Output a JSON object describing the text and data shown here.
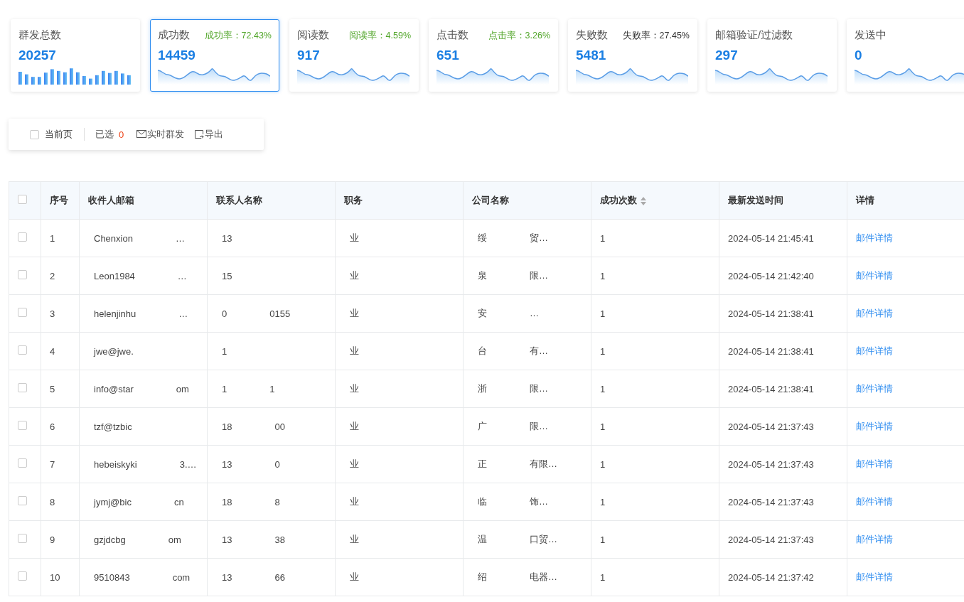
{
  "stats": [
    {
      "title": "群发总数",
      "value": "20257",
      "kind": "bars",
      "selected": false
    },
    {
      "title": "成功数",
      "value": "14459",
      "kind": "wave",
      "selected": true,
      "rate": {
        "text": "成功率：72.43%",
        "kind": "positive"
      }
    },
    {
      "title": "阅读数",
      "value": "917",
      "kind": "wave",
      "selected": false,
      "rate": {
        "text": "阅读率：4.59%",
        "kind": "positive"
      }
    },
    {
      "title": "点击数",
      "value": "651",
      "kind": "wave",
      "selected": false,
      "rate": {
        "text": "点击率：3.26%",
        "kind": "positive"
      }
    },
    {
      "title": "失败数",
      "value": "5481",
      "kind": "wave",
      "selected": false,
      "rate": {
        "text": "失败率：27.45%",
        "kind": "neutral"
      }
    },
    {
      "title": "邮箱验证/过滤数",
      "value": "297",
      "kind": "wave",
      "selected": false
    },
    {
      "title": "发送中",
      "value": "0",
      "kind": "wave",
      "selected": false
    }
  ],
  "toolbar": {
    "page_checkbox": {
      "label": "当前页",
      "checked": false
    },
    "selected_label": "已选",
    "selected_count": "0",
    "send_button": "实时群发",
    "export_button": "导出"
  },
  "table": {
    "all_checked": false,
    "columns": [
      {
        "label": "序号"
      },
      {
        "label": "收件人邮箱"
      },
      {
        "label": "联系人名称"
      },
      {
        "label": "职务"
      },
      {
        "label": "公司名称"
      },
      {
        "label": "成功次数",
        "sortable": true
      },
      {
        "label": "最新发送时间"
      },
      {
        "label": "详情"
      }
    ],
    "rows": [
      {
        "checked": false,
        "index": "1",
        "email": [
          "Chenxion",
          "…"
        ],
        "contact": [
          "13"
        ],
        "job": [
          "业"
        ],
        "company": [
          "绥",
          "贸…"
        ],
        "count": "1",
        "time": "2024-05-14 21:45:41",
        "link": "邮件详情"
      },
      {
        "checked": false,
        "index": "2",
        "email": [
          "Leon1984",
          "…"
        ],
        "contact": [
          "15"
        ],
        "job": [
          "业"
        ],
        "company": [
          "泉",
          "限…"
        ],
        "count": "1",
        "time": "2024-05-14 21:42:40",
        "link": "邮件详情"
      },
      {
        "checked": false,
        "index": "3",
        "email": [
          "helenjinhu",
          "…"
        ],
        "contact": [
          "0",
          "0155"
        ],
        "job": [
          "业"
        ],
        "company": [
          "安",
          "…"
        ],
        "count": "1",
        "time": "2024-05-14 21:38:41",
        "link": "邮件详情"
      },
      {
        "checked": false,
        "index": "4",
        "email": [
          "jwe@jwe."
        ],
        "contact": [
          "1"
        ],
        "job": [
          "业"
        ],
        "company": [
          "台",
          "有…"
        ],
        "count": "1",
        "time": "2024-05-14 21:38:41",
        "link": "邮件详情"
      },
      {
        "checked": false,
        "index": "5",
        "email": [
          "info@star",
          "om"
        ],
        "contact": [
          "1",
          "1"
        ],
        "job": [
          "业"
        ],
        "company": [
          "浙",
          "限…"
        ],
        "count": "1",
        "time": "2024-05-14 21:38:41",
        "link": "邮件详情"
      },
      {
        "checked": false,
        "index": "6",
        "email": [
          "tzf@tzbic"
        ],
        "contact": [
          "18",
          "00"
        ],
        "job": [
          "业"
        ],
        "company": [
          "广",
          "限…"
        ],
        "count": "1",
        "time": "2024-05-14 21:37:43",
        "link": "邮件详情"
      },
      {
        "checked": false,
        "index": "7",
        "email": [
          "hebeiskyki",
          "3.…"
        ],
        "contact": [
          "13",
          "0"
        ],
        "job": [
          "业"
        ],
        "company": [
          "正",
          "有限…"
        ],
        "count": "1",
        "time": "2024-05-14 21:37:43",
        "link": "邮件详情"
      },
      {
        "checked": false,
        "index": "8",
        "email": [
          "jymj@bic",
          "cn"
        ],
        "contact": [
          "18",
          "8"
        ],
        "job": [
          "业"
        ],
        "company": [
          "临",
          "饰…"
        ],
        "count": "1",
        "time": "2024-05-14 21:37:43",
        "link": "邮件详情"
      },
      {
        "checked": false,
        "index": "9",
        "email": [
          "gzjdcbg",
          "om"
        ],
        "contact": [
          "13",
          "38"
        ],
        "job": [
          "业"
        ],
        "company": [
          "温",
          "口贸…"
        ],
        "count": "1",
        "time": "2024-05-14 21:37:43",
        "link": "邮件详情"
      },
      {
        "checked": false,
        "index": "10",
        "email": [
          "9510843",
          "com"
        ],
        "contact": [
          "13",
          "66"
        ],
        "job": [
          "业"
        ],
        "company": [
          "绍",
          "电器…"
        ],
        "count": "1",
        "time": "2024-05-14 21:37:42",
        "link": "邮件详情"
      }
    ]
  }
}
